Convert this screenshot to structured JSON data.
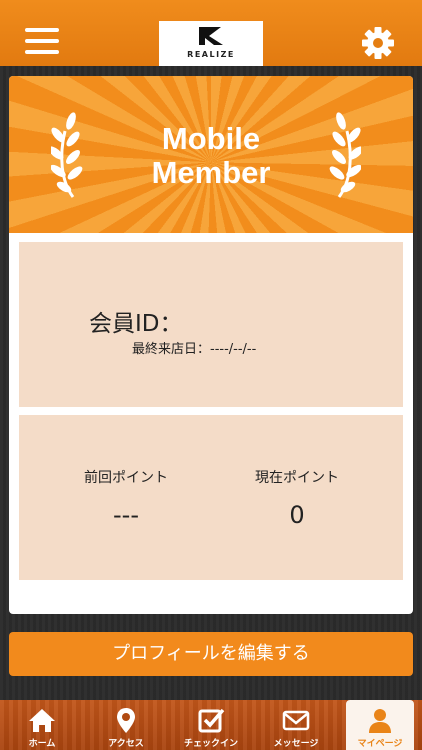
{
  "header": {
    "logo_text": "REALIZE",
    "menu_icon": "hamburger-menu-icon",
    "settings_icon": "gear-icon"
  },
  "banner": {
    "title_line1": "Mobile",
    "title_line2": "Member"
  },
  "member": {
    "id_label": "会員ID：",
    "last_visit": "最終来店日：----/--/--"
  },
  "points": {
    "previous_label": "前回ポイント",
    "previous_value": "---",
    "current_label": "現在ポイント",
    "current_value": "0"
  },
  "actions": {
    "edit_profile": "プロフィールを編集する"
  },
  "tabs": [
    {
      "label": "ホーム",
      "icon": "home-icon",
      "active": false
    },
    {
      "label": "アクセス",
      "icon": "map-pin-icon",
      "active": false
    },
    {
      "label": "チェックイン",
      "icon": "checkin-icon",
      "active": false
    },
    {
      "label": "メッセージ",
      "icon": "mail-icon",
      "active": false
    },
    {
      "label": "マイページ",
      "icon": "person-icon",
      "active": true
    }
  ],
  "colors": {
    "accent": "#f28a1c",
    "panel": "#f4dcc8",
    "tab_bar": "#b14b12"
  }
}
